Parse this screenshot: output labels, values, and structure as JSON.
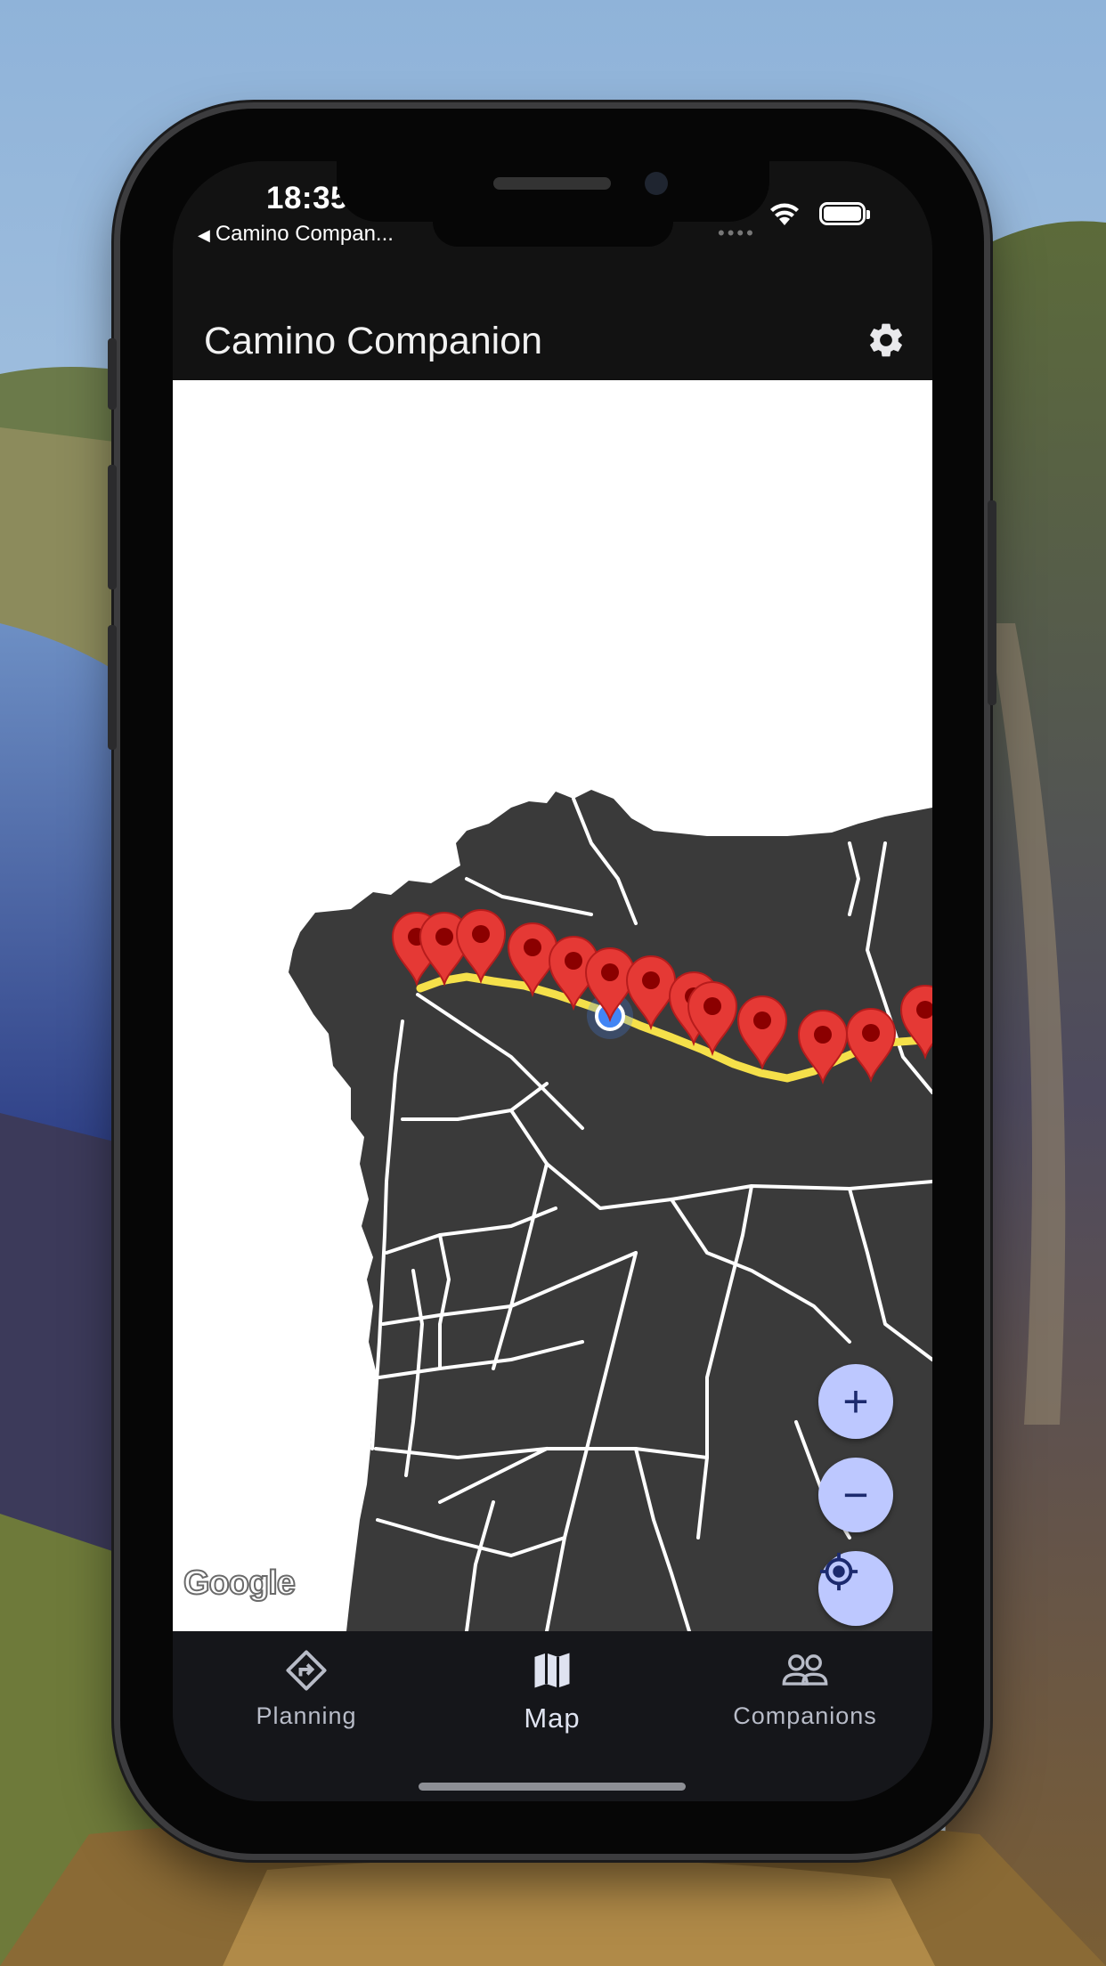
{
  "status_bar": {
    "time": "18:35",
    "back_app": "Camino Compan...",
    "dots": "••••"
  },
  "app_bar": {
    "title": "Camino Companion",
    "settings_icon": "gear-icon"
  },
  "map": {
    "attribution": "Google",
    "controls": {
      "zoom_in": "+",
      "zoom_out": "−",
      "locate_icon": "my-location-icon"
    },
    "route_color": "#f5e04a",
    "marker_color": "#e53935",
    "user_location_color": "#4285f4",
    "land_color": "#3a3a3a",
    "water_color": "#ffffff"
  },
  "bottom_nav": {
    "items": [
      {
        "label": "Planning",
        "icon": "directions-icon",
        "active": false
      },
      {
        "label": "Map",
        "icon": "map-icon",
        "active": true
      },
      {
        "label": "Companions",
        "icon": "people-icon",
        "active": false
      }
    ]
  }
}
